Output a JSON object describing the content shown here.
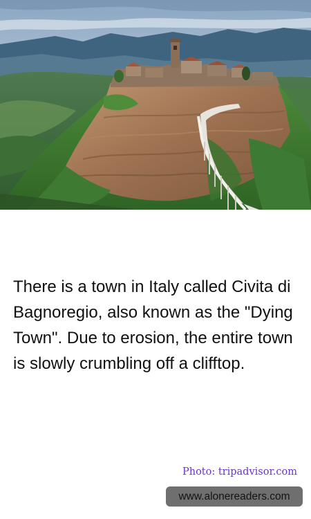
{
  "photo": {
    "subject": "Civita di Bagnoregio hilltop town with footbridge"
  },
  "caption": {
    "text": "There is a town in Italy called Civita di Bagnoregio, also known as the \"Dying Town\". Due to erosion, the entire town is slowly crumbling off a clifftop."
  },
  "credit": {
    "text": "Photo: tripadvisor.com"
  },
  "site": {
    "url": "www.alonereaders.com"
  },
  "colors": {
    "credit_text": "#6a35c7",
    "badge_background": "#6f6f6f",
    "caption_text": "#111111"
  }
}
